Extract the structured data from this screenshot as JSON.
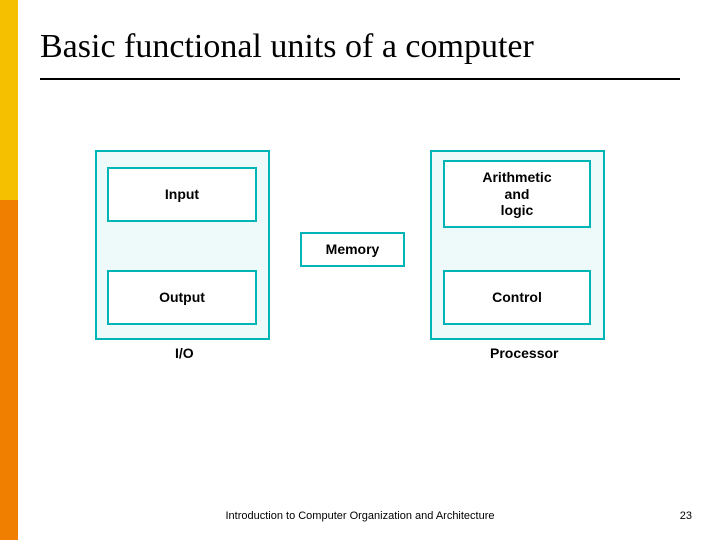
{
  "slide": {
    "title": "Basic functional units of a computer",
    "footer": "Introduction to Computer Organization and Architecture",
    "page_number": "23"
  },
  "diagram": {
    "io_group": {
      "label": "I/O",
      "input_label": "Input",
      "output_label": "Output"
    },
    "processor_group": {
      "label": "Processor",
      "alu_label": "Arithmetic\nand\nlogic",
      "control_label": "Control"
    },
    "memory_label": "Memory"
  },
  "colors": {
    "box_border": "#00b5b5",
    "group_bg": "#eefafa",
    "accent_gold": "#f5c000",
    "accent_orange": "#f07f00"
  }
}
